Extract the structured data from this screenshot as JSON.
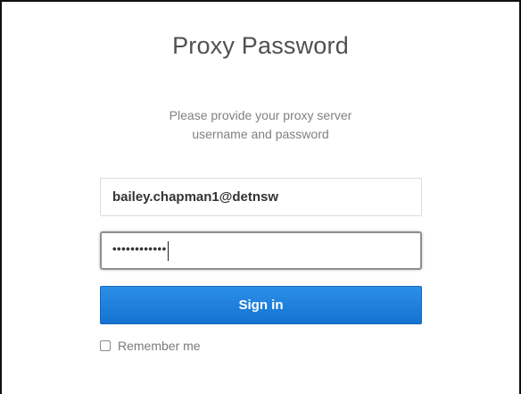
{
  "dialog": {
    "title": "Proxy Password",
    "subtitle_line1": "Please provide your proxy server",
    "subtitle_line2": "username and password"
  },
  "form": {
    "username_value": "bailey.chapman1@detnsw",
    "password_mask": "••••••••••••",
    "sign_in_label": "Sign in",
    "remember_label": "Remember me",
    "remember_checked": false
  },
  "colors": {
    "button_blue": "#1a7fdc",
    "title_gray": "#505050",
    "subtitle_gray": "#808080"
  }
}
